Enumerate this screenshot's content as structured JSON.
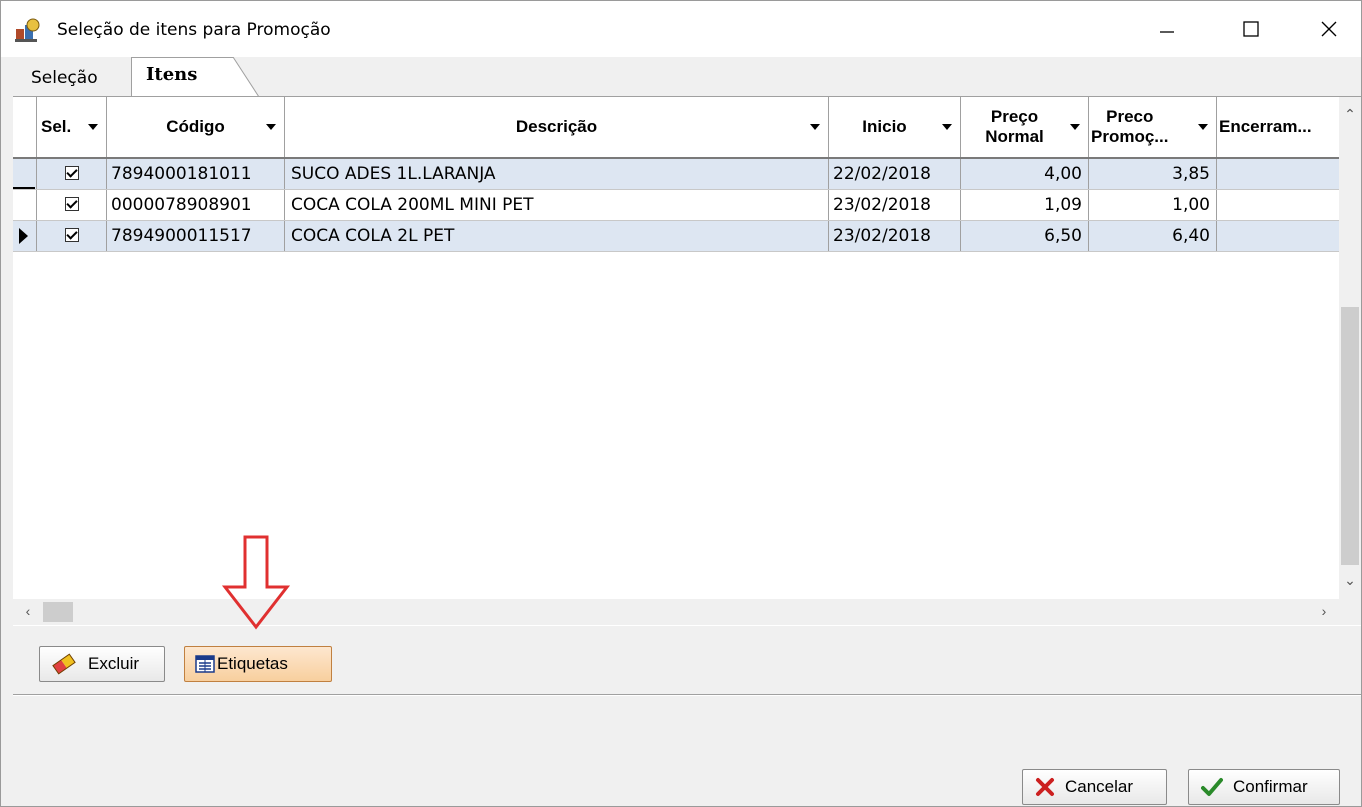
{
  "window": {
    "title": "Seleção de itens para Promoção"
  },
  "tabs": [
    {
      "label": "Seleção"
    },
    {
      "label": "Itens",
      "active": true
    }
  ],
  "grid": {
    "columns": [
      "Sel.",
      "Código",
      "Descrição",
      "Inicio",
      "Preço Normal",
      "Preco Promoç...",
      "Encerram..."
    ],
    "column_labels": {
      "sel": "Sel.",
      "codigo": "Código",
      "descricao": "Descrição",
      "inicio": "Inicio",
      "preco_normal_1": "Preço",
      "preco_normal_2": "Normal",
      "preco_promo_1": "Preco",
      "preco_promo_2": "Promoç...",
      "encerramento": "Encerram..."
    },
    "rows": [
      {
        "selected": true,
        "codigo": "7894000181011",
        "descricao": "SUCO ADES 1L.LARANJA",
        "inicio": "22/02/2018",
        "preco_normal": "4,00",
        "preco_promocao": "3,85"
      },
      {
        "selected": true,
        "codigo": "0000078908901",
        "descricao": "COCA COLA 200ML MINI PET",
        "inicio": "23/02/2018",
        "preco_normal": "1,09",
        "preco_promocao": "1,00"
      },
      {
        "selected": true,
        "codigo": "7894900011517",
        "descricao": "COCA COLA 2L PET",
        "inicio": "23/02/2018",
        "preco_normal": "6,50",
        "preco_promocao": "6,40",
        "current": true
      }
    ]
  },
  "buttons": {
    "excluir": "Excluir",
    "etiquetas": "Etiquetas",
    "cancelar": "Cancelar",
    "confirmar": "Confirmar"
  },
  "colors": {
    "alt_row": "#dde6f2",
    "annotation_arrow": "#e03030",
    "cancel_icon": "#cc2020",
    "confirm_icon": "#2a8a2a"
  },
  "icons": {
    "app": "app-icon",
    "excluir": "eraser-icon",
    "etiquetas": "label-sheet-icon",
    "cancelar": "x-icon",
    "confirmar": "check-icon"
  }
}
